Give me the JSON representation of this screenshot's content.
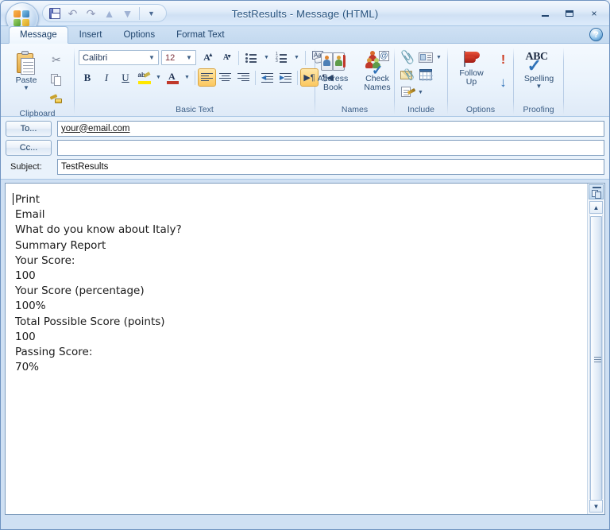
{
  "window": {
    "title": "TestResults - Message (HTML)",
    "minimize_label": "Minimize",
    "maximize_label": "Maximize",
    "close_label": "×"
  },
  "quick_access": {
    "office_button": "Office Button",
    "items": [
      {
        "name": "save",
        "label": "Save"
      },
      {
        "name": "undo",
        "label": "Undo",
        "glyph": "↶"
      },
      {
        "name": "redo",
        "label": "Redo",
        "glyph": "↷"
      },
      {
        "name": "previous-item",
        "label": "Previous Item",
        "glyph": "▲"
      },
      {
        "name": "next-item",
        "label": "Next Item",
        "glyph": "▼"
      },
      {
        "name": "customize",
        "label": "Customize Quick Access Toolbar",
        "glyph": "☲"
      }
    ]
  },
  "tabs": [
    {
      "label": "Message",
      "active": true
    },
    {
      "label": "Insert",
      "active": false
    },
    {
      "label": "Options",
      "active": false
    },
    {
      "label": "Format Text",
      "active": false
    }
  ],
  "help_button": "?",
  "ribbon": {
    "groups": [
      {
        "name": "clipboard",
        "label": "Clipboard",
        "has_launcher": true,
        "buttons": [
          {
            "name": "paste",
            "label": "Paste",
            "caret": "▾"
          },
          {
            "name": "cut",
            "label": "Cut"
          },
          {
            "name": "copy",
            "label": "Copy"
          },
          {
            "name": "format-painter",
            "label": "Format Painter"
          }
        ]
      },
      {
        "name": "basic-text",
        "label": "Basic Text",
        "has_launcher": true,
        "font_name": "Calibri",
        "font_size": "12",
        "buttons": [
          {
            "name": "grow-font",
            "label": "Grow Font"
          },
          {
            "name": "shrink-font",
            "label": "Shrink Font"
          },
          {
            "name": "bullets",
            "label": "Bullets"
          },
          {
            "name": "numbering",
            "label": "Numbering"
          },
          {
            "name": "clear-formatting",
            "label": "Clear Formatting"
          },
          {
            "name": "bold",
            "label": "B"
          },
          {
            "name": "italic",
            "label": "I"
          },
          {
            "name": "underline",
            "label": "U"
          },
          {
            "name": "text-highlight-color",
            "label": "Text Highlight Color"
          },
          {
            "name": "font-color",
            "label": "Font Color"
          },
          {
            "name": "align-left",
            "label": "Align Text Left",
            "active": true
          },
          {
            "name": "align-center",
            "label": "Center"
          },
          {
            "name": "align-right",
            "label": "Align Text Right"
          },
          {
            "name": "decrease-indent",
            "label": "Decrease Indent"
          },
          {
            "name": "increase-indent",
            "label": "Increase Indent"
          },
          {
            "name": "ltr-text-direction",
            "label": "Left-to-Right Text Direction",
            "active": true
          },
          {
            "name": "rtl-text-direction",
            "label": "Right-to-Left Text Direction"
          }
        ]
      },
      {
        "name": "names",
        "label": "Names",
        "has_launcher": false,
        "buttons": [
          {
            "name": "address-book",
            "label": "Address\nBook"
          },
          {
            "name": "check-names",
            "label": "Check\nNames"
          }
        ]
      },
      {
        "name": "include",
        "label": "Include",
        "has_launcher": true,
        "buttons": [
          {
            "name": "attach-file",
            "label": "Attach File"
          },
          {
            "name": "business-card",
            "label": "Business Card"
          },
          {
            "name": "attach-item",
            "label": "Attach Item"
          },
          {
            "name": "calendar",
            "label": "Calendar"
          },
          {
            "name": "signature",
            "label": "Signature"
          }
        ]
      },
      {
        "name": "options",
        "label": "Options",
        "has_launcher": true,
        "buttons": [
          {
            "name": "follow-up",
            "label": "Follow\nUp",
            "caret": "▾"
          },
          {
            "name": "high-importance",
            "label": "High Importance"
          },
          {
            "name": "low-importance",
            "label": "Low Importance"
          }
        ]
      },
      {
        "name": "proofing",
        "label": "Proofing",
        "has_launcher": false,
        "buttons": [
          {
            "name": "spelling",
            "label": "Spelling",
            "caret": "▾"
          }
        ]
      }
    ],
    "follow_up_label_line1": "Follow",
    "follow_up_label_line2": "Up",
    "spelling_label": "Spelling",
    "address_book_line1": "Address",
    "address_book_line2": "Book",
    "check_names_line1": "Check",
    "check_names_line2": "Names",
    "paste_label": "Paste"
  },
  "headers": {
    "to_button": "To...",
    "to_value": "your@email.com",
    "cc_button": "Cc...",
    "cc_value": "",
    "subject_label": "Subject:",
    "subject_value": "TestResults"
  },
  "body": {
    "lines": [
      "Print",
      "Email",
      "What do you know about Italy?",
      "Summary Report",
      "Your Score:",
      "100",
      "Your Score (percentage)",
      "100%",
      "Total Possible Score (points)",
      "100",
      "Passing Score:",
      "70%"
    ]
  },
  "scrollbar": {
    "up_arrow": "▲",
    "down_arrow": "▼",
    "ribbon_toggle_label": "Expand/Collapse"
  },
  "colors": {
    "accent": "#2f72b8",
    "title_text": "#26527e",
    "highlight": "#fbc85f",
    "importance_high": "#cc3a20",
    "importance_low": "#2f72b8"
  }
}
